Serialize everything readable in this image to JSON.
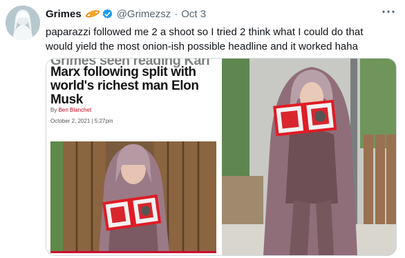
{
  "tweet": {
    "author_name": "Grimes",
    "handle": "@Grimezsz",
    "separator": "·",
    "date": "Oct 3",
    "text": "paparazzi followed me 2 a shoot so I tried 2 think what I could do that\nwould yield the most onion-ish possible headline and it worked haha",
    "icons": {
      "avatar": "avatar",
      "emoji": "planet-emoji-icon",
      "verified": "verified-badge-icon",
      "more": "more-icon"
    },
    "colors": {
      "verified": "#1d9bf0",
      "muted": "#536471",
      "byline_red": "#d0021b"
    }
  },
  "media": {
    "article": {
      "cut_headline": "Grimes seen reading Karl",
      "headline": "Marx following split with\nworld's richest man Elon\nMusk",
      "byline_prefix": "By",
      "byline_author": "Ben Blanchet",
      "dateline": "October 2, 2021 | 5:27pm"
    }
  }
}
